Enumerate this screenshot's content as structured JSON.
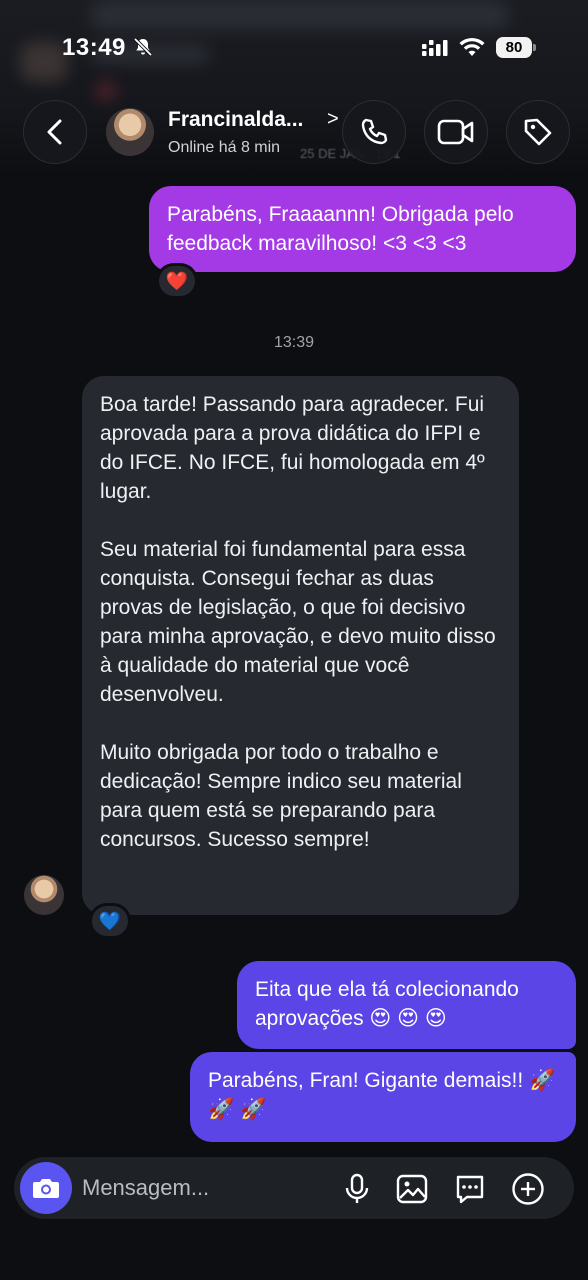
{
  "status_bar": {
    "time": "13:49",
    "battery": "80"
  },
  "header": {
    "name": "Francinalda...",
    "chevron": ">",
    "status": "Online há 8 min",
    "background_date": "25 DE JAN., 19:1"
  },
  "messages": [
    {
      "id": "m1",
      "direction": "out",
      "text": "Parabéns, Fraaaannn! Obrigada pelo feedback maravilhoso! <3 <3 <3",
      "reaction": "❤️"
    },
    {
      "id": "ts",
      "timestamp": "13:39"
    },
    {
      "id": "m2",
      "direction": "in",
      "paragraphs": [
        "Boa tarde! Passando para agradecer. Fui aprovada para a prova didática do IFPI e do IFCE. No IFCE, fui homologada em 4º lugar.",
        "Seu material foi fundamental para essa conquista. Consegui fechar as duas provas de legislação, o que foi decisivo para minha aprovação, e devo muito disso à qualidade do material que você desenvolveu.",
        "Muito obrigada por todo o trabalho e dedicação! Sempre indico seu material para quem está se preparando para concursos. Sucesso sempre!"
      ],
      "reaction": "💙"
    },
    {
      "id": "m3",
      "direction": "out",
      "text": "Eita que ela tá colecionando aprovações 😍 😍 😍"
    },
    {
      "id": "m4",
      "direction": "out",
      "text": "Parabéns, Fran! Gigante demais!! 🚀 🚀 🚀"
    }
  ],
  "composer": {
    "placeholder": "Mensagem..."
  },
  "icons": {
    "back": "chevron-left-icon",
    "call": "phone-icon",
    "video": "video-icon",
    "tag": "tag-icon",
    "camera": "camera-icon",
    "mic": "microphone-icon",
    "gallery": "image-icon",
    "sticker": "chat-bubble-icon",
    "add": "plus-circle-icon"
  },
  "colors": {
    "background": "#0c0e11",
    "outgoing_purple": "#a43ae6",
    "outgoing_violet": "#5b45e6",
    "incoming": "#262a30",
    "camera_button": "#5a55f0"
  }
}
